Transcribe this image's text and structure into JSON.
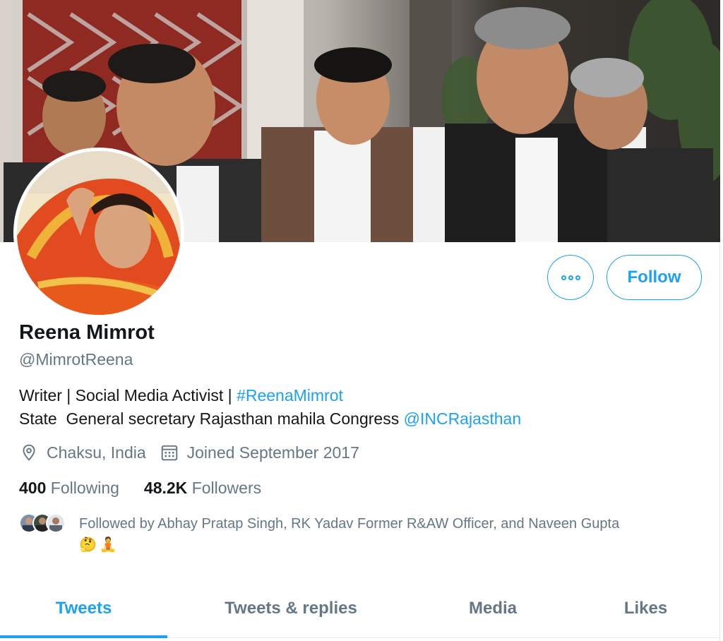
{
  "profile": {
    "name": "Reena Mimrot",
    "handle": "@MimrotReena",
    "bio_line1_text": "Writer | Social Media Activist | ",
    "bio_line1_hashtag": "#ReenaMimrot",
    "bio_line2_text": "State  General secretary Rajasthan mahila Congress ",
    "bio_line2_mention": "@INCRajasthan",
    "location": "Chaksu, India",
    "joined": "Joined September 2017"
  },
  "actions": {
    "more_icon": "more-horizontal-icon",
    "follow_label": "Follow"
  },
  "stats": {
    "following_count": "400",
    "following_label": "Following",
    "followers_count": "48.2K",
    "followers_label": "Followers"
  },
  "followed_by": {
    "text": "Followed by Abhay Pratap Singh, RK Yadav Former R&AW Officer, and Naveen Gupta",
    "emojis": [
      "🤔",
      "🧘"
    ]
  },
  "tabs": [
    {
      "label": "Tweets",
      "active": true
    },
    {
      "label": "Tweets & replies",
      "active": false
    },
    {
      "label": "Media",
      "active": false
    },
    {
      "label": "Likes",
      "active": false
    }
  ],
  "colors": {
    "accent": "#1da1f2",
    "secondary_text": "#657786",
    "primary_text": "#14171a",
    "border": "#e6ecf0"
  },
  "icons": {
    "location": "location-pin-icon",
    "joined": "calendar-icon"
  }
}
